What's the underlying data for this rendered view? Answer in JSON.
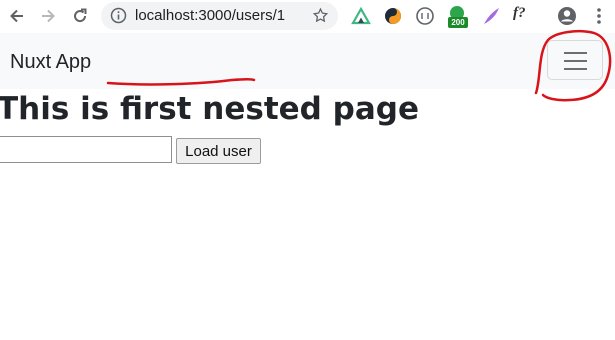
{
  "browser": {
    "url": "localhost:3000/users/1",
    "extension_badge": "200",
    "extension_label": "f?"
  },
  "navbar": {
    "brand": "Nuxt App"
  },
  "main": {
    "title": "This is first nested page",
    "user_input_value": "",
    "load_button_label": "Load user"
  },
  "colors": {
    "navbar_bg": "#f8f9fa",
    "annotation_red": "#d8141b",
    "badge_green": "#1a8a2a"
  }
}
